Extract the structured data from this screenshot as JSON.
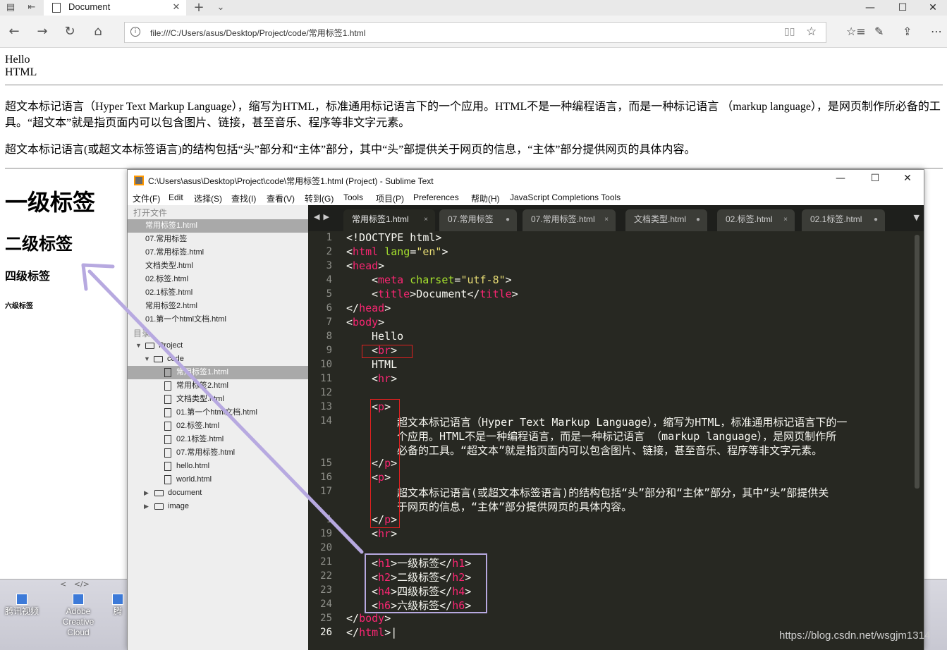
{
  "browser": {
    "tab_title": "Document",
    "url": "file:///C:/Users/asus/Desktop/Project/code/常用标签1.html"
  },
  "page": {
    "hello": "Hello",
    "html_word": "HTML",
    "para1": "超文本标记语言（Hyper Text Markup Language），缩写为HTML，标准通用标记语言下的一个应用。HTML不是一种编程语言，而是一种标记语言 （markup language），是网页制作所必备的工具。“超文本”就是指页面内可以包含图片、链接，甚至音乐、程序等非文字元素。",
    "para2": "超文本标记语言(或超文本标签语言)的结构包括“头”部分和“主体”部分，其中“头”部提供关于网页的信息，“主体”部分提供网页的具体内容。",
    "h1": "一级标签",
    "h2": "二级标签",
    "h4": "四级标签",
    "h6": "六级标签"
  },
  "desktop": {
    "icons": [
      "腾讯视频",
      "Adobe Creative Cloud",
      "腾"
    ]
  },
  "sublime": {
    "title": "C:\\Users\\asus\\Desktop\\Project\\code\\常用标签1.html (Project) - Sublime Text",
    "menu": [
      "文件(F)",
      "Edit",
      "选择(S)",
      "查找(I)",
      "查看(V)",
      "转到(G)",
      "Tools",
      "项目(P)",
      "Preferences",
      "帮助(H)",
      "JavaScript Completions Tools"
    ],
    "sidebar": {
      "open_files_label": "打开文件",
      "open_files": [
        "常用标签1.html",
        "07.常用标签",
        "07.常用标签.html",
        "文档类型.html",
        "02.标签.html",
        "02.1标签.html",
        "常用标签2.html",
        "01.第一个html文档.html"
      ],
      "folders_label": "目录",
      "tree": {
        "project": "Project",
        "code": "code",
        "files": [
          "常用标签1.html",
          "常用标签2.html",
          "文档类型.html",
          "01.第一个html文档.html",
          "02.标签.html",
          "02.1标签.html",
          "07.常用标签.html",
          "hello.html",
          "world.html"
        ],
        "folders": [
          "document",
          "image"
        ]
      }
    },
    "tabs": [
      {
        "label": "常用标签1.html",
        "mark": "×"
      },
      {
        "label": "07.常用标签",
        "mark": "●"
      },
      {
        "label": "07.常用标签.html",
        "mark": "×"
      },
      {
        "label": "文档类型.html",
        "mark": "●"
      },
      {
        "label": "02.标签.html",
        "mark": "×"
      },
      {
        "label": "02.1标签.html",
        "mark": "●"
      }
    ],
    "line_numbers": [
      "1",
      "2",
      "3",
      "4",
      "5",
      "6",
      "7",
      "8",
      "9",
      "10",
      "11",
      "12",
      "13",
      "14",
      "15",
      "16",
      "17",
      "1",
      "19",
      "20",
      "21",
      "22",
      "23",
      "24",
      "25",
      "26"
    ],
    "code": {
      "l14_text": "超文本标记语言（Hyper Text Markup Language），缩写为HTML，标准通用标记语言下的一",
      "l14_wrap1": "个应用。HTML不是一种编程语言，而是一种标记语言 （markup language），是网页制作所",
      "l14_wrap2": "必备的工具。“超文本”就是指页面内可以包含图片、链接，甚至音乐、程序等非文字元素。",
      "l17_text": "超文本标记语言(或超文本标签语言)的结构包括“头”部分和“主体”部分，其中“头”部提供关",
      "l17_wrap1": "于网页的信息，“主体”部分提供网页的具体内容。",
      "h1_text": "一级标签",
      "h2_text": "二级标签",
      "h4_text": "四级标签",
      "h6_text": "六级标签"
    }
  },
  "watermark": "https://blog.csdn.net/wsgjm1314",
  "colors": {
    "editor_bg": "#272822",
    "tag": "#f92672",
    "attr": "#a6e22e",
    "string": "#e6db74",
    "annotation_red": "#e02020",
    "annotation_purple": "#b7a9e0"
  }
}
